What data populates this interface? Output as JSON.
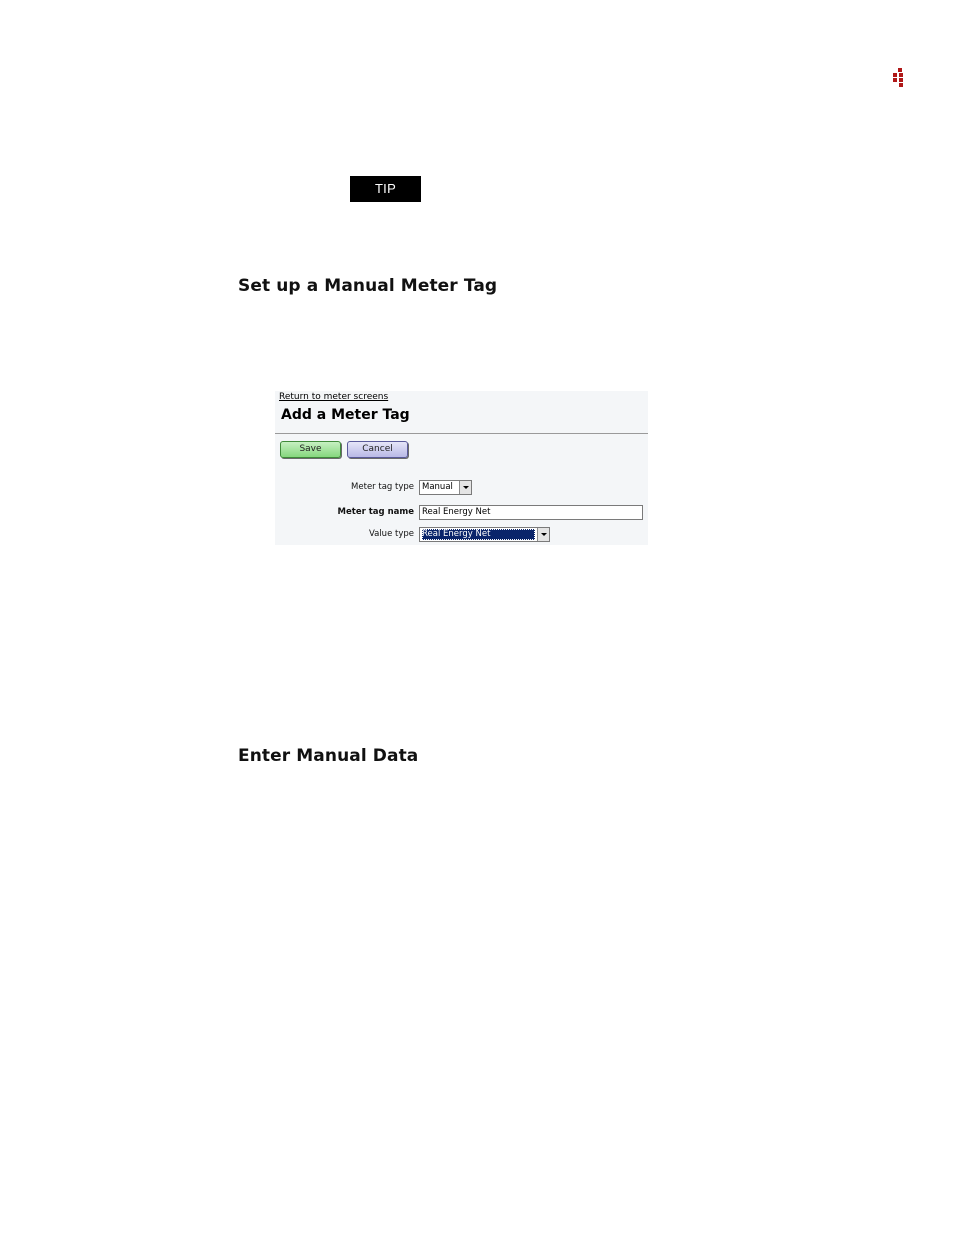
{
  "tip_label": "TIP",
  "sections": {
    "setup_heading": "Set up a Manual Meter Tag",
    "enter_heading": "Enter Manual Data"
  },
  "form": {
    "return_link": "Return to meter screens",
    "title": "Add a Meter Tag",
    "save_label": "Save",
    "cancel_label": "Cancel",
    "meter_tag_type_label": "Meter tag type",
    "meter_tag_type_value": "Manual",
    "meter_tag_name_label": "Meter tag name",
    "meter_tag_name_value": "Real Energy Net",
    "value_type_label": "Value type",
    "value_type_value": "Real Energy Net"
  },
  "colors": {
    "brand_red": "#b01818",
    "tip_bg": "#000000",
    "save_green": "#86d77e",
    "cancel_lavender": "#b9b9e6",
    "selection_blue": "#0a246a"
  },
  "icons": {
    "logo": "brand-logo-icon",
    "dropdown_arrow": "chevron-down-icon"
  }
}
